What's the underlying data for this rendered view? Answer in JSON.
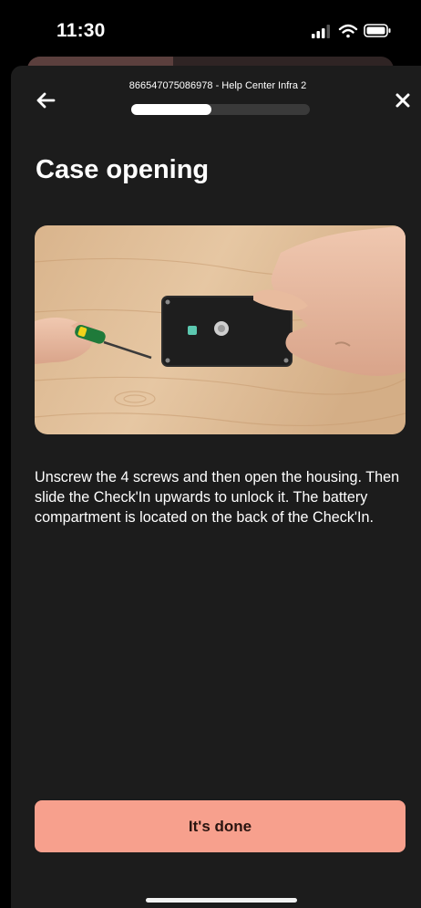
{
  "status_bar": {
    "time": "11:30",
    "icons": [
      "cellular-signal-icon",
      "wifi-icon",
      "battery-icon"
    ]
  },
  "header": {
    "subtitle": "866547075086978 - Help Center Infra 2",
    "progress": 0.45,
    "back_icon": "arrow-left-icon",
    "close_icon": "close-icon"
  },
  "content": {
    "title": "Case opening",
    "media_description_icon": "device-photo",
    "instructions": "Unscrew the 4 screws and then open the housing. Then slide the Check'In upwards to unlock it. The battery compartment is located on the back of the Check'In."
  },
  "footer": {
    "done_label": "It's done"
  },
  "colors": {
    "background": "#000000",
    "sheet": "#1c1c1c",
    "accent": "#f7a08d",
    "text": "#ffffff"
  }
}
